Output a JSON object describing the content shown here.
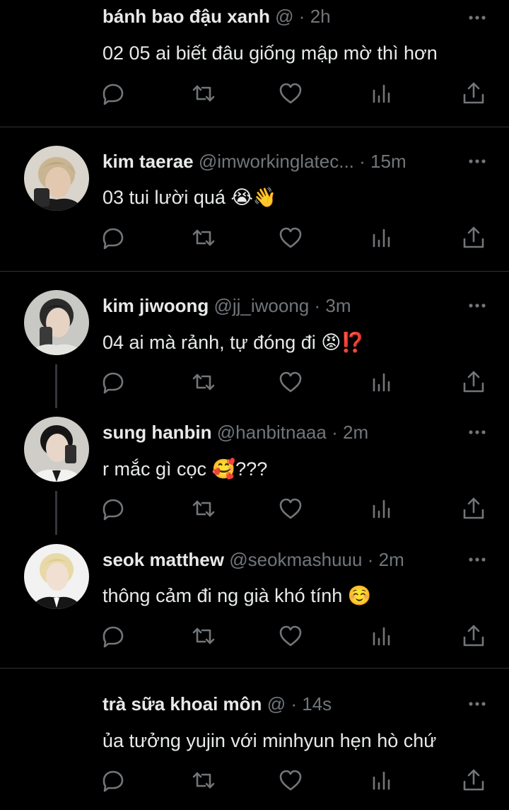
{
  "tweets": [
    {
      "name": "bánh bao đậu xanh",
      "handle": "@",
      "dot": "·",
      "time": "2h",
      "text": "02 05 ai biết đâu giống mập mờ thì hơn",
      "avatar": ""
    },
    {
      "name": "kim taerae",
      "handle": "@imworkinglatec...",
      "dot": "·",
      "time": "15m",
      "text": "03 tui lười quá 😭👋",
      "avatar": "avatar-blond"
    },
    {
      "name": "kim jiwoong",
      "handle": "@jj_iwoong",
      "dot": "·",
      "time": "3m",
      "text": "04 ai mà rảnh, tự đóng đi 😡⁉️",
      "avatar": "avatar-dark"
    },
    {
      "name": "sung hanbin",
      "handle": "@hanbitnaaa",
      "dot": "·",
      "time": "2m",
      "text": "r mắc gì cọc 🥰???",
      "avatar": "avatar-dark"
    },
    {
      "name": "seok matthew",
      "handle": "@seokmashuuu",
      "dot": "·",
      "time": "2m",
      "text": "thông cảm đi ng già khó tính ☺️",
      "avatar": "avatar-light"
    },
    {
      "name": "trà sữa khoai môn",
      "handle": "@",
      "dot": "·",
      "time": "14s",
      "text": "ủa tưởng yujin với minhyun hẹn hò chứ",
      "avatar": ""
    }
  ],
  "icons": {
    "reply": "reply-icon",
    "retweet": "retweet-icon",
    "like": "heart-icon",
    "views": "analytics-icon",
    "share": "share-icon",
    "more": "more-dots-icon"
  },
  "colors": {
    "background": "#000000",
    "text": "#e7e9ea",
    "secondary": "#71767b",
    "divider": "#2f3336",
    "thread_line": "#333639"
  }
}
